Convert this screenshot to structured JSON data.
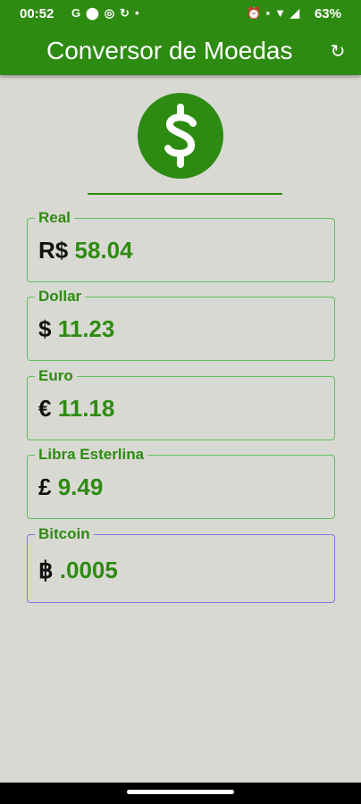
{
  "status_bar": {
    "time": "00:52",
    "left_icons": [
      "g-icon",
      "location-icon",
      "media-icon",
      "sync-icon",
      "dot-icon"
    ],
    "right_icons": [
      "alarm-icon",
      "volte-icon",
      "wifi-icon",
      "signal-icon"
    ],
    "battery": "63%"
  },
  "app_bar": {
    "title": "Conversor de Moedas",
    "action_icon": "refresh-icon"
  },
  "logo": {
    "icon": "dollar-circle-icon"
  },
  "currencies": [
    {
      "label": "Real",
      "symbol": "R$",
      "amount": "58.04"
    },
    {
      "label": "Dollar",
      "symbol": "$",
      "amount": "11.23"
    },
    {
      "label": "Euro",
      "symbol": "€",
      "amount": "11.18"
    },
    {
      "label": "Libra Esterlina",
      "symbol": "£",
      "amount": "9.49"
    },
    {
      "label": "Bitcoin",
      "symbol": "฿",
      "amount": ".0005"
    }
  ],
  "colors": {
    "primary": "#2e8b12",
    "background": "#d9d9d3",
    "field_border": "#5fbf5f",
    "focused_border": "#7b7be0"
  }
}
